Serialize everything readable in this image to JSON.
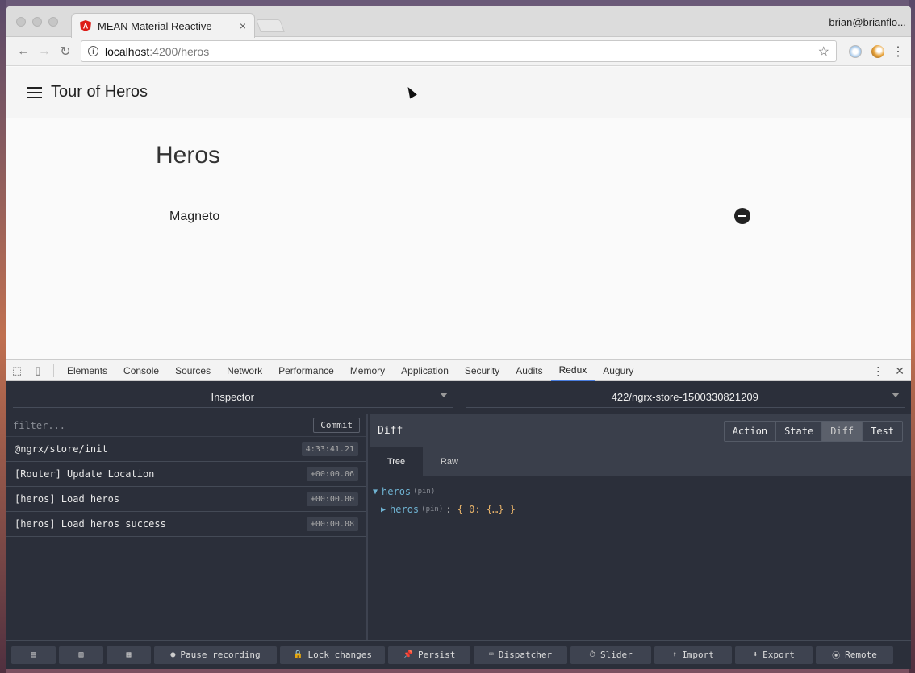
{
  "browser": {
    "tab_title": "MEAN Material Reactive",
    "tab_close": "×",
    "profile": "brian@brianflo...",
    "url_host": "localhost",
    "url_path": ":4200/heros"
  },
  "app": {
    "title": "Tour of Heros",
    "heading": "Heros",
    "heroes": [
      "Magneto"
    ]
  },
  "devtools": {
    "tabs": [
      "Elements",
      "Console",
      "Sources",
      "Network",
      "Performance",
      "Memory",
      "Application",
      "Security",
      "Audits",
      "Redux",
      "Augury"
    ],
    "active_tab": "Redux"
  },
  "redux": {
    "monitor": "Inspector",
    "instance": "422/ngrx-store-1500330821209",
    "filter_placeholder": "filter...",
    "commit_label": "Commit",
    "actions": [
      {
        "name": "@ngrx/store/init",
        "time": "4:33:41.21"
      },
      {
        "name": "[Router] Update Location",
        "time": "+00:00.06"
      },
      {
        "name": "[heros] Load heros",
        "time": "+00:00.00"
      },
      {
        "name": "[heros] Load heros success",
        "time": "+00:00.08"
      }
    ],
    "panel_label": "Diff",
    "view_buttons": [
      "Action",
      "State",
      "Diff",
      "Test"
    ],
    "active_view": "Diff",
    "subtabs": [
      "Tree",
      "Raw"
    ],
    "active_subtab": "Tree",
    "tree": {
      "root_key": "heros",
      "pin": "(pin)",
      "child_key": "heros",
      "child_value": "{ 0: {…} }"
    },
    "bottom_buttons": [
      {
        "icon": "▤",
        "label": ""
      },
      {
        "icon": "▥",
        "label": ""
      },
      {
        "icon": "▦",
        "label": ""
      },
      {
        "icon": "●",
        "label": "Pause recording"
      },
      {
        "icon": "🔒",
        "label": "Lock changes"
      },
      {
        "icon": "📌",
        "label": "Persist"
      },
      {
        "icon": "⌨",
        "label": "Dispatcher"
      },
      {
        "icon": "⏱",
        "label": "Slider"
      },
      {
        "icon": "⬆",
        "label": "Import"
      },
      {
        "icon": "⬇",
        "label": "Export"
      },
      {
        "icon": "⦿",
        "label": "Remote"
      }
    ]
  }
}
